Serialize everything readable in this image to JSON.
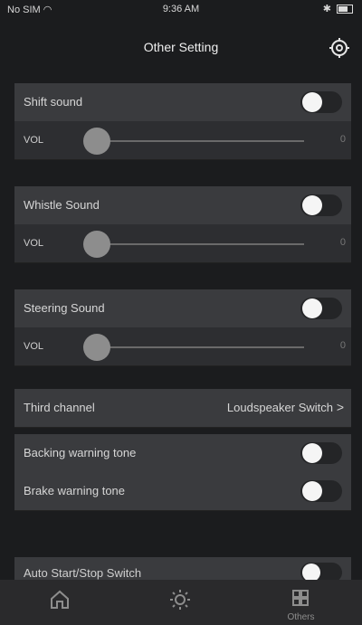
{
  "status_bar": {
    "carrier": "No SIM",
    "time": "9:36 AM"
  },
  "header": {
    "title": "Other Setting",
    "settings_icon": "gear-icon"
  },
  "sections": [
    {
      "title": "Shift sound",
      "toggle_on": false,
      "vol_label": "VOL",
      "vol_value": "0",
      "vol_level": 0
    },
    {
      "title": "Whistle Sound",
      "toggle_on": false,
      "vol_label": "VOL",
      "vol_value": "0",
      "vol_level": 0
    },
    {
      "title": "Steering Sound",
      "toggle_on": false,
      "vol_label": "VOL",
      "vol_value": "0",
      "vol_level": 0
    }
  ],
  "third_channel": {
    "label": "Third channel",
    "value": "Loudspeaker Switch",
    "chevron": ">"
  },
  "warnings": [
    {
      "label": "Backing warning tone",
      "toggle_on": false
    },
    {
      "label": "Brake warning tone",
      "toggle_on": false
    }
  ],
  "partial_row": {
    "label": "Auto Start/Stop Switch",
    "toggle_on": false
  },
  "tabbar": {
    "tabs": [
      {
        "icon": "home-icon",
        "label": ""
      },
      {
        "icon": "light-icon",
        "label": ""
      },
      {
        "icon": "others-icon",
        "label": "Others"
      }
    ]
  }
}
